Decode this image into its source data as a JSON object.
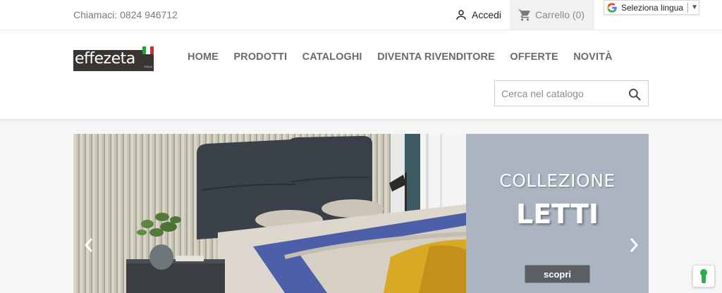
{
  "topbar": {
    "phone": "Chiamaci: 0824 946712",
    "login_label": "Accedi",
    "cart_label": "Carrello (0)",
    "language_label": "Seleziona lingua"
  },
  "header": {
    "logo_text": "effezeta",
    "logo_sub": "ITALIA",
    "nav": [
      "HOME",
      "PRODOTTI",
      "CATALOGHI",
      "DIVENTA RIVENDITORE",
      "OFFERTE",
      "NOVITÀ"
    ],
    "search_placeholder": "Cerca nel catalogo"
  },
  "slider": {
    "heading": "COLLEZIONE",
    "title": "LETTI",
    "cta": "scopri"
  },
  "colors": {
    "panel": "#aab5c1",
    "cta": "#5b5f63",
    "privacy_icon": "#2eaa4a"
  },
  "icons": [
    "person-icon",
    "cart-icon",
    "google-icon",
    "search-icon",
    "chevron-left-icon",
    "chevron-right-icon",
    "keyhole-icon"
  ]
}
